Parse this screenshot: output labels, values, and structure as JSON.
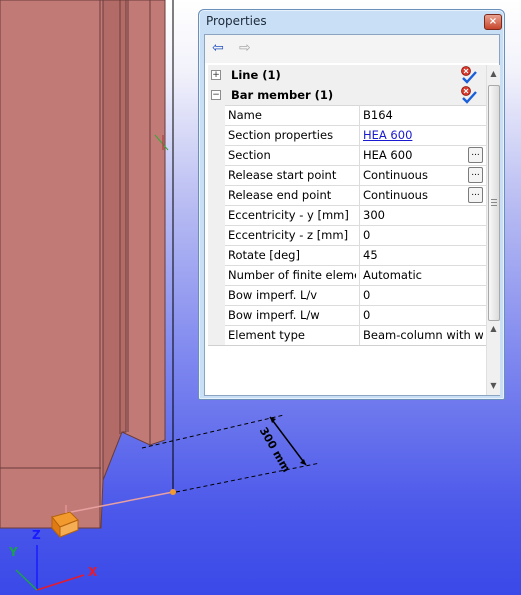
{
  "viewport": {
    "dimension_label": "300 mm",
    "axes": {
      "z": "Z",
      "y": "Y",
      "x": "X"
    },
    "colors": {
      "beam": "#c27a77",
      "beam_dark": "#a85f5c",
      "support": "#f29a2e"
    }
  },
  "panel": {
    "title": "Properties",
    "close_glyph": "×",
    "back_glyph": "⇦",
    "forward_glyph": "⇨",
    "groups": [
      {
        "toggle": "+",
        "label": "Line (1)"
      },
      {
        "toggle": "−",
        "label": "Bar member (1)"
      }
    ],
    "properties": [
      {
        "name": "Name",
        "value": "B164"
      },
      {
        "name": "Section properties",
        "value": "HEA 600"
      },
      {
        "name": "Section",
        "value": "HEA 600",
        "button": "..."
      },
      {
        "name": "Release start point",
        "value": "Continuous",
        "button": "..."
      },
      {
        "name": "Release end point",
        "value": "Continuous",
        "button": "..."
      },
      {
        "name": "Eccentricity - y [mm]",
        "value": "300"
      },
      {
        "name": "Eccentricity - z [mm]",
        "value": "0"
      },
      {
        "name": "Rotate [deg]",
        "value": "45"
      },
      {
        "name": "Number of finite elements",
        "value": "Automatic"
      },
      {
        "name": "Bow imperf. L/v",
        "value": "0"
      },
      {
        "name": "Bow imperf. L/w",
        "value": "0"
      },
      {
        "name": "Element type",
        "value": "Beam-column with warping"
      }
    ],
    "scroll_up": "▲",
    "scroll_down": "▼"
  }
}
